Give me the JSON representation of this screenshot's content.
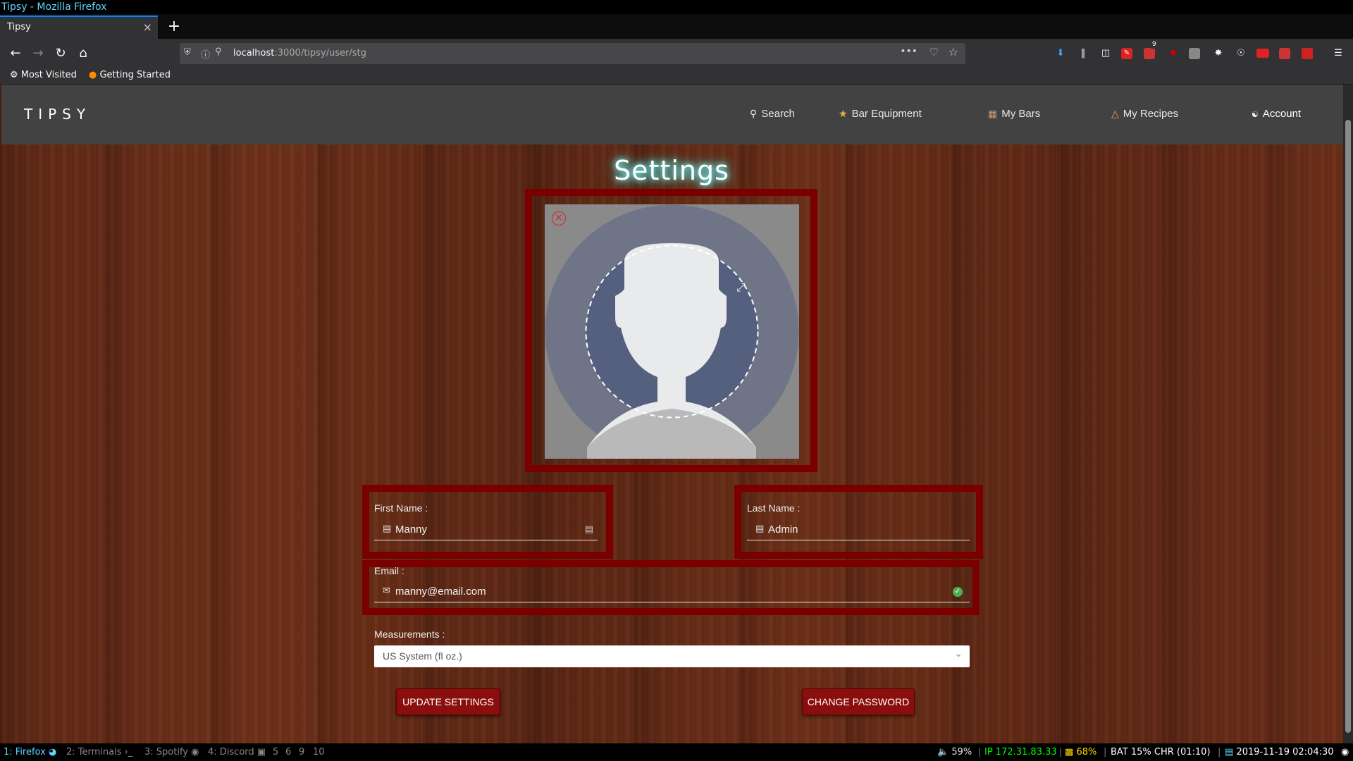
{
  "window": {
    "title": "Tipsy - Mozilla Firefox"
  },
  "browser": {
    "tab_title": "Tipsy",
    "tab_close": "×",
    "new_tab": "+",
    "url_host": "localhost",
    "url_path": ":3000/tipsy/user/stg",
    "url_dots": "•••",
    "bookmarks": [
      "Most Visited",
      "Getting Started"
    ],
    "ext_badge": "9"
  },
  "app": {
    "logo": "TIPSY",
    "nav": [
      {
        "label": "Search",
        "icon": "search-icon"
      },
      {
        "label": "Bar Equipment",
        "icon": "bar-equipment-icon"
      },
      {
        "label": "My Bars",
        "icon": "bar-icon"
      },
      {
        "label": "My Recipes",
        "icon": "bottle-icon"
      },
      {
        "label": "Account",
        "icon": "account-icon"
      }
    ]
  },
  "settings": {
    "title": "Settings",
    "first_name": {
      "label": "First Name :",
      "value": "Manny"
    },
    "last_name": {
      "label": "Last Name :",
      "value": "Admin"
    },
    "email": {
      "label": "Email :",
      "value": "manny@email.com"
    },
    "measurements": {
      "label": "Measurements :",
      "value": "US System (fl oz.)"
    },
    "update_button": "UPDATE SETTINGS",
    "password_button": "CHANGE PASSWORD"
  },
  "taskbar": {
    "workspaces": [
      "1: Firefox",
      "2: Terminals",
      "3: Spotify",
      "4: Discord",
      "5",
      "6",
      "9",
      "10"
    ],
    "volume": "59%",
    "ip": "IP 172.31.83.33",
    "wifi": "68%",
    "battery": "BAT 15% CHR (01:10)",
    "datetime": "2019-11-19 02:04:30"
  },
  "colors": {
    "accent_red": "#7a0000",
    "button_red": "#8b0e0e",
    "header_gray": "#424242",
    "workspace_active": "#5fd7ff",
    "ip_green": "#00ff00",
    "wifi_yellow": "#ffd700"
  }
}
